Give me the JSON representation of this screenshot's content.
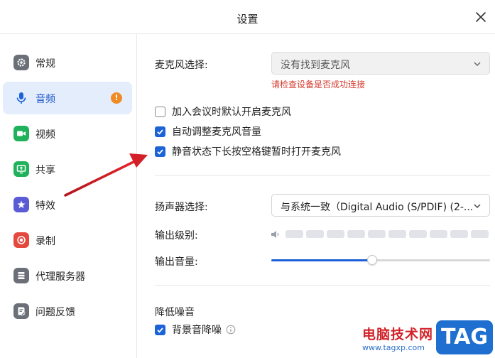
{
  "window": {
    "title": "设置"
  },
  "sidebar": {
    "items": [
      {
        "label": "常规",
        "icon": "gear-icon",
        "color": "#6b6f78"
      },
      {
        "label": "音频",
        "icon": "microphone-icon",
        "color": "#1c63d8",
        "badge": "!"
      },
      {
        "label": "视频",
        "icon": "video-camera-icon",
        "color": "#1fb25a"
      },
      {
        "label": "共享",
        "icon": "screen-share-icon",
        "color": "#1fb25a"
      },
      {
        "label": "特效",
        "icon": "effects-star-icon",
        "color": "#5b5bd6"
      },
      {
        "label": "录制",
        "icon": "record-icon",
        "color": "#e5483d"
      },
      {
        "label": "代理服务器",
        "icon": "list-icon",
        "color": "#6b6f78"
      },
      {
        "label": "问题反馈",
        "icon": "feedback-icon",
        "color": "#6b6f78"
      }
    ],
    "active_index": 1,
    "accent": "#1a55c9"
  },
  "mic": {
    "label": "麦克风选择:",
    "value": "没有找到麦克风",
    "warning": "请检查设备是否成功连接",
    "options": [
      {
        "label": "加入会议时默认开启麦克风",
        "checked": false
      },
      {
        "label": "自动调整麦克风音量",
        "checked": true
      },
      {
        "label": "静音状态下长按空格键暂时打开麦克风",
        "checked": true
      }
    ]
  },
  "speaker": {
    "label": "扬声器选择:",
    "value": "与系统一致（Digital Audio (S/PDIF) (2-...",
    "output_level_label": "输出级别:",
    "output_level_segments": 10,
    "output_level_active": 0,
    "output_volume_label": "输出音量:",
    "output_volume": 0.46
  },
  "noise": {
    "title": "降低噪音",
    "background_label": "背景音降噪",
    "background_checked": true
  },
  "watermark": {
    "text": "电脑技术网",
    "url": "www.tagxp.com",
    "logo": "TAG"
  }
}
